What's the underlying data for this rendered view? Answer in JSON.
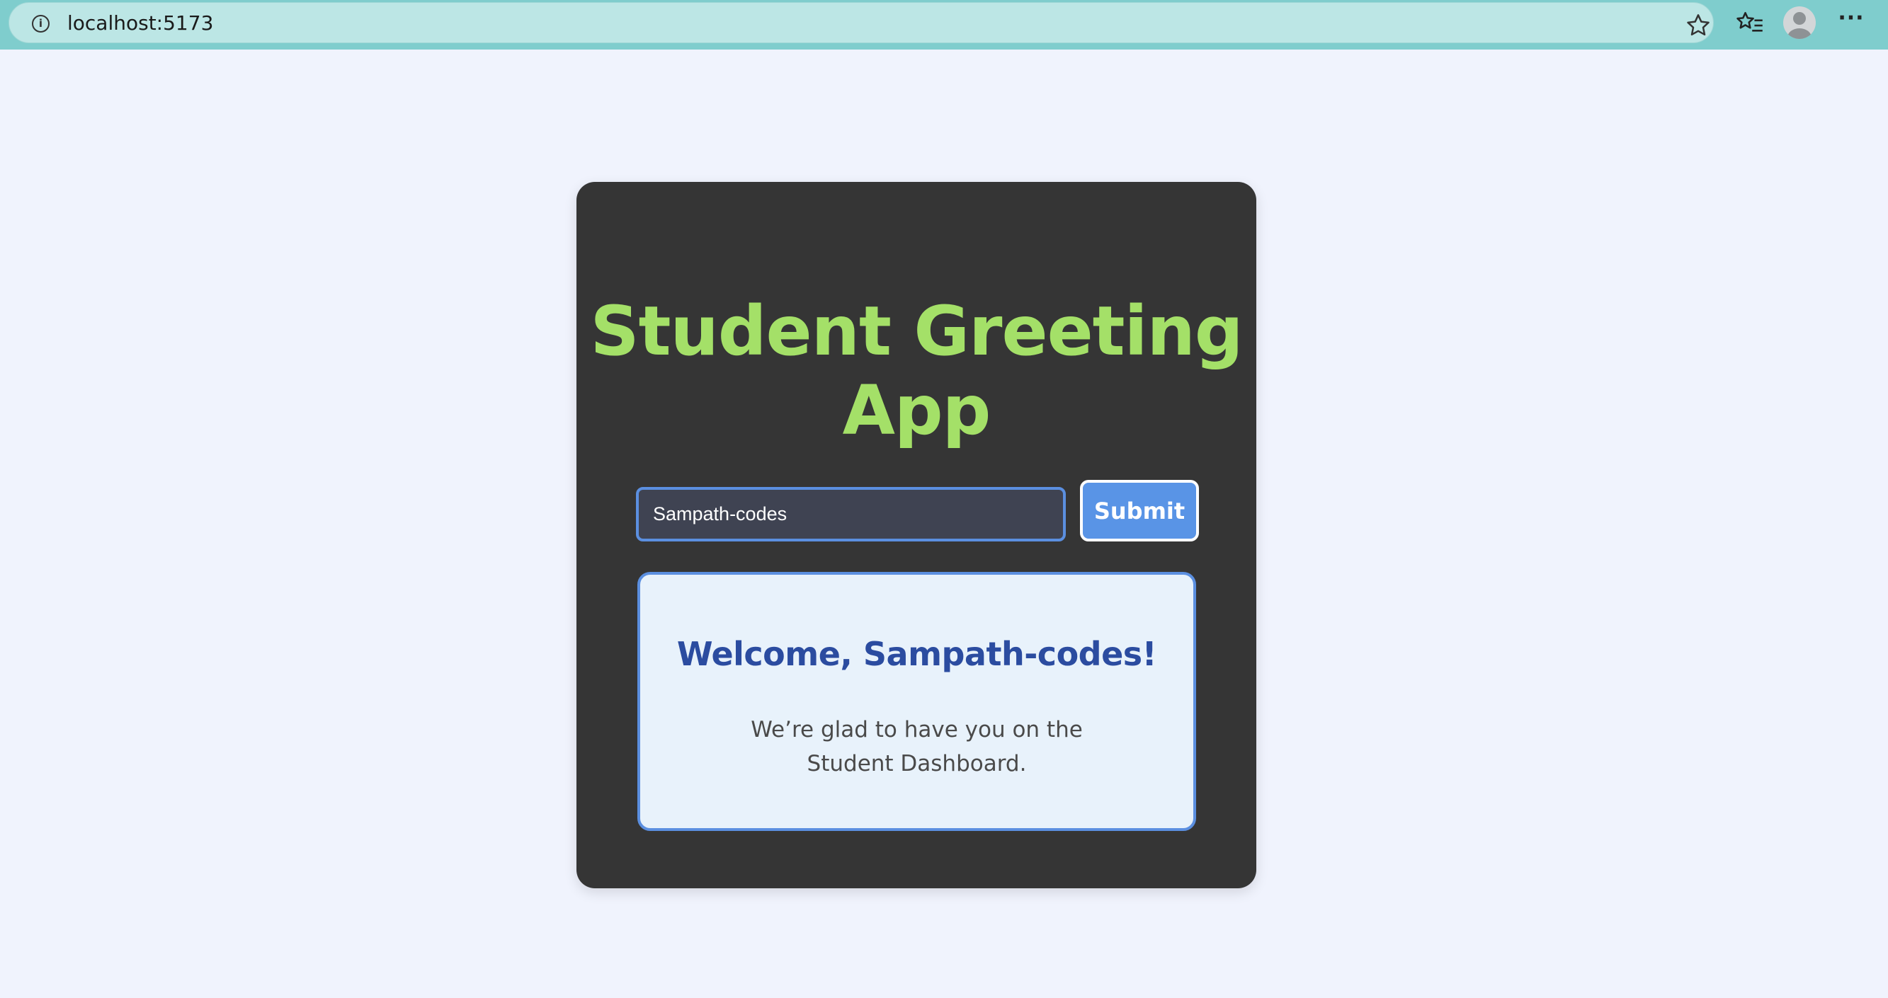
{
  "browser": {
    "url": "localhost:5173",
    "icons": {
      "info": "info-icon",
      "favorite": "star-icon",
      "favorites_list": "favorites-icon",
      "profile": "avatar",
      "menu": "more-icon"
    },
    "bar_color": "#7fcdcd"
  },
  "app": {
    "title": "Student Greeting App",
    "input": {
      "value": "Sampath-codes",
      "placeholder": ""
    },
    "submit_label": "Submit",
    "welcome": {
      "heading": "Welcome, Sampath-codes!",
      "message": "We’re glad to have you on the Student Dashboard."
    }
  },
  "colors": {
    "page_background": "#f0f3fd",
    "card_background": "#353535",
    "title": "#a4e068",
    "accent": "#5994e6",
    "welcome_heading": "#2b4ca0",
    "welcome_background": "#e8f2fb"
  }
}
